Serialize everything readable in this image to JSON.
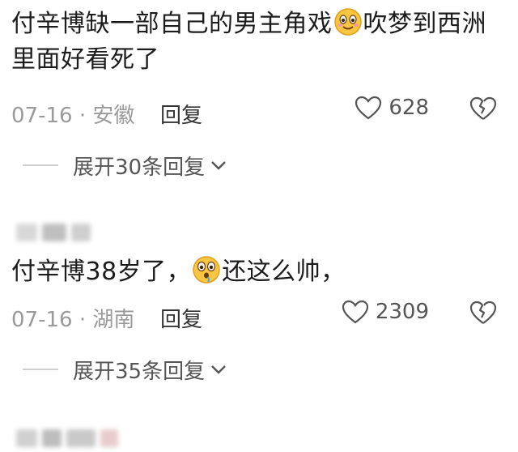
{
  "comments": [
    {
      "text_before": "付辛博缺一部自己的男主角戏",
      "emoji": "blush-smile-emoji",
      "text_after": "吹梦到西洲里面好看死了",
      "date_location": "07-16 · 安徽",
      "reply_label": "回复",
      "likes": "628",
      "expand_label": "展开30条回复"
    },
    {
      "text_before": "付辛博38岁了，",
      "emoji": "drooling-emoji",
      "text_after": "还这么帅，",
      "date_location": "07-16 · 湖南",
      "reply_label": "回复",
      "likes": "2309",
      "expand_label": "展开35条回复"
    }
  ],
  "colors": {
    "meta": "#9a9a9a",
    "text": "#1c1c1c",
    "emoji": "#f8c640"
  }
}
